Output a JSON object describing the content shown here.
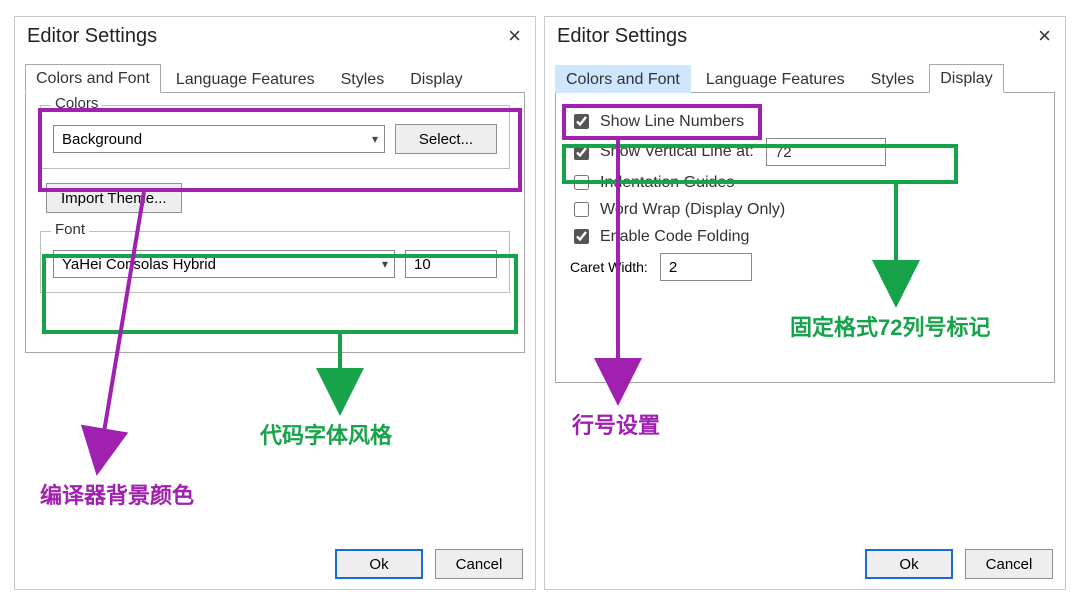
{
  "left": {
    "window_title": "Editor Settings",
    "tabs": [
      "Colors and Font",
      "Language Features",
      "Styles",
      "Display"
    ],
    "active_tab": 0,
    "colors_group": {
      "legend": "Colors",
      "value": "Background",
      "select_btn": "Select..."
    },
    "import_btn": "Import Theme...",
    "font_group": {
      "legend": "Font",
      "value": "YaHei Consolas Hybrid",
      "size": "10"
    },
    "buttons": {
      "ok": "Ok",
      "cancel": "Cancel"
    }
  },
  "right": {
    "window_title": "Editor Settings",
    "tabs": [
      "Colors and Font",
      "Language Features",
      "Styles",
      "Display"
    ],
    "active_tab": 3,
    "display": {
      "show_line_numbers": {
        "label": "Show Line Numbers",
        "checked": true
      },
      "show_vline": {
        "label": "Show Vertical Line at:",
        "checked": true,
        "value": "72"
      },
      "indent_guides": {
        "label": "Indentation Guides",
        "checked": false
      },
      "word_wrap": {
        "label": "Word Wrap (Display Only)",
        "checked": false
      },
      "code_folding": {
        "label": "Enable Code Folding",
        "checked": true
      },
      "caret_width": {
        "label": "Caret Width:",
        "value": "2"
      }
    },
    "buttons": {
      "ok": "Ok",
      "cancel": "Cancel"
    }
  },
  "annotations": {
    "left_purple_label": "编译器背景颜色",
    "left_green_label": "代码字体风格",
    "right_purple_label": "行号设置",
    "right_green_label": "固定格式72列号标记"
  }
}
